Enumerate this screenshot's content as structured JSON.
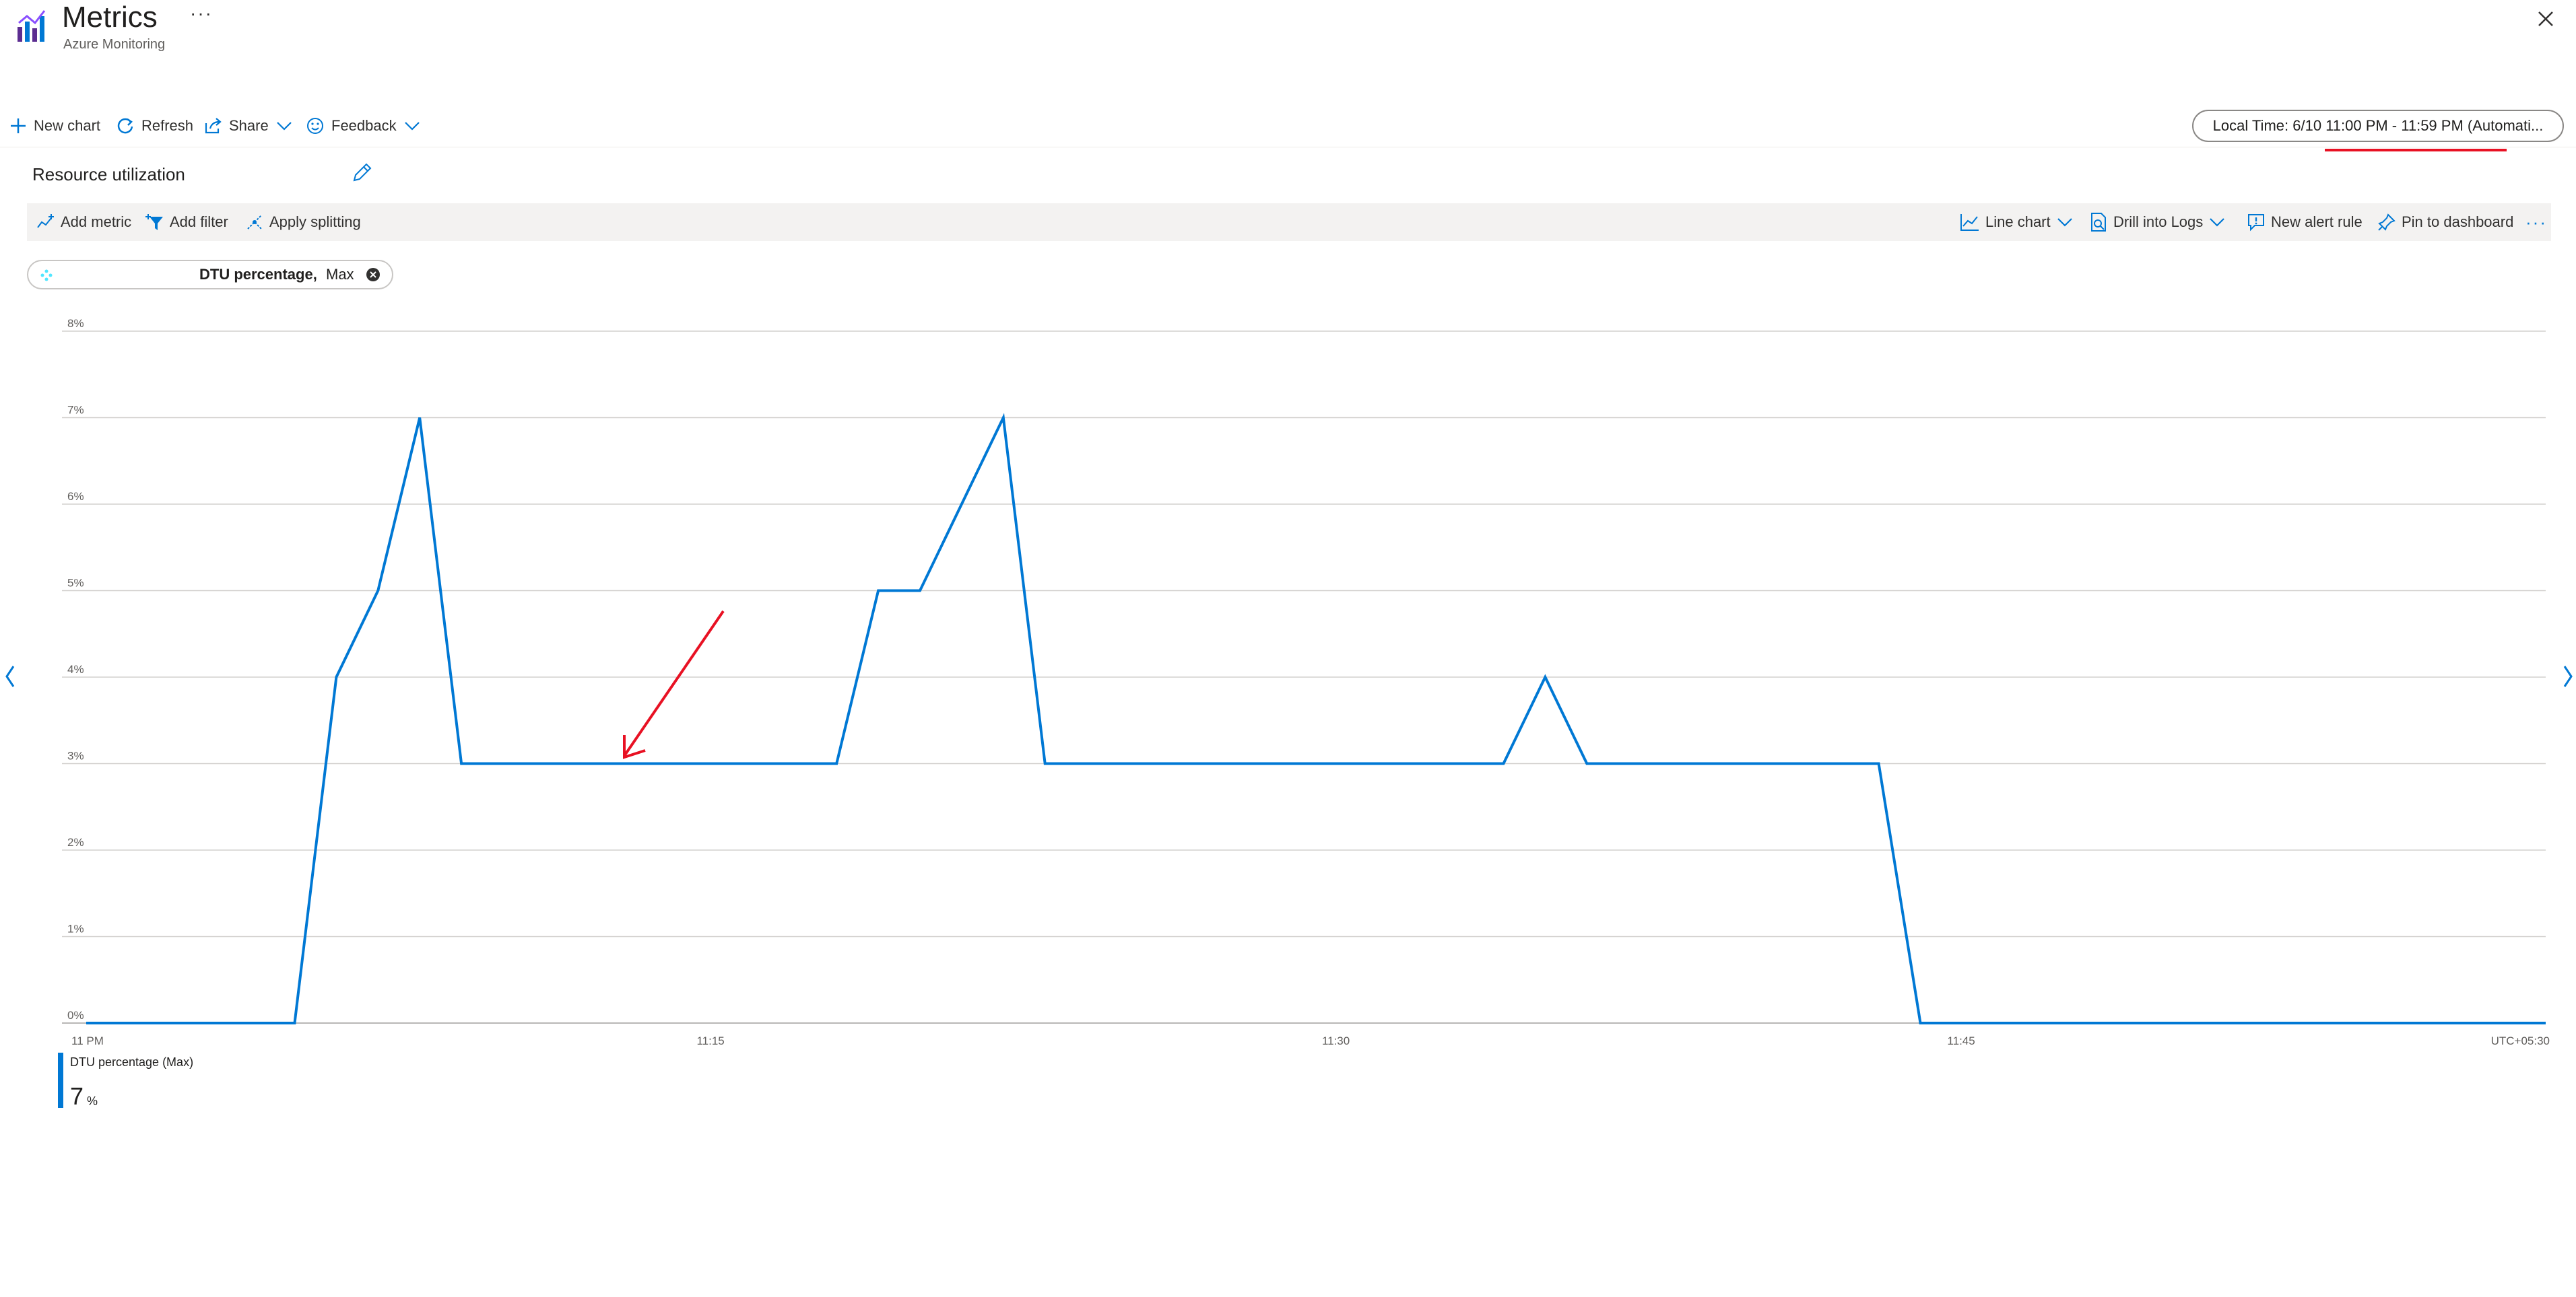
{
  "header": {
    "title": "Metrics",
    "subtitle": "Azure Monitoring",
    "more": "···"
  },
  "commands": {
    "new_chart": "New chart",
    "refresh": "Refresh",
    "share": "Share",
    "feedback": "Feedback"
  },
  "time_range": "Local Time: 6/10 11:00 PM - 11:59 PM (Automati...",
  "chart_title": "Resource utilization",
  "toolbar": {
    "add_metric": "Add metric",
    "add_filter": "Add filter",
    "apply_splitting": "Apply splitting",
    "line_chart": "Line chart",
    "drill_logs": "Drill into Logs",
    "new_alert": "New alert rule",
    "pin": "Pin to dashboard",
    "more": "···"
  },
  "metric_pill": {
    "name": "DTU percentage,",
    "aggregation": "Max"
  },
  "legend": {
    "name": "DTU percentage (Max)",
    "value": "7",
    "unit": "%"
  },
  "colors": {
    "series": "#0078d4",
    "annotation": "#e81123",
    "toolbar_bg": "#f3f2f1"
  },
  "icons": [
    "metrics-app-icon",
    "close-icon",
    "plus-icon",
    "refresh-icon",
    "share-icon",
    "feedback-icon",
    "chevron-down-icon",
    "edit-icon",
    "add-metric-icon",
    "add-filter-icon",
    "apply-splitting-icon",
    "line-chart-icon",
    "logs-icon",
    "alert-icon",
    "pin-icon",
    "chevron-left-icon",
    "chevron-right-icon"
  ],
  "chart_data": {
    "type": "line",
    "ylim": [
      0,
      8
    ],
    "y_ticks": [
      0,
      1,
      2,
      3,
      4,
      5,
      6,
      7,
      8
    ],
    "y_tick_labels": [
      "0%",
      "1%",
      "2%",
      "3%",
      "4%",
      "5%",
      "6%",
      "7%",
      "8%"
    ],
    "x_tick_labels": [
      {
        "minute": 0,
        "label": "11 PM"
      },
      {
        "minute": 15,
        "label": "11:15"
      },
      {
        "minute": 30,
        "label": "11:30"
      },
      {
        "minute": 45,
        "label": "11:45"
      }
    ],
    "timezone_label": "UTC+05:30",
    "xlim": [
      0,
      59
    ],
    "series": [
      {
        "name": "DTU percentage (Max)",
        "x": [
          0,
          1,
          2,
          3,
          4,
          5,
          6,
          7,
          8,
          9,
          10,
          11,
          12,
          13,
          14,
          15,
          16,
          17,
          18,
          19,
          20,
          21,
          22,
          23,
          24,
          25,
          26,
          27,
          28,
          29,
          30,
          31,
          32,
          33,
          34,
          35,
          36,
          37,
          38,
          39,
          40,
          41,
          42,
          43,
          44,
          45,
          46,
          47,
          48,
          49,
          50,
          51,
          52,
          53,
          54,
          55,
          56,
          57,
          58,
          59
        ],
        "values": [
          0,
          0,
          0,
          0,
          0,
          0,
          4,
          5,
          7,
          3,
          3,
          3,
          3,
          3,
          3,
          3,
          3,
          3,
          3,
          5,
          5,
          6,
          7,
          3,
          3,
          3,
          3,
          3,
          3,
          3,
          3,
          3,
          3,
          3,
          3,
          4,
          3,
          3,
          3,
          3,
          3,
          3,
          3,
          3,
          0,
          0,
          0,
          0,
          0,
          0,
          0,
          0,
          0,
          0,
          0,
          0,
          0,
          0,
          0,
          0
        ]
      }
    ]
  }
}
